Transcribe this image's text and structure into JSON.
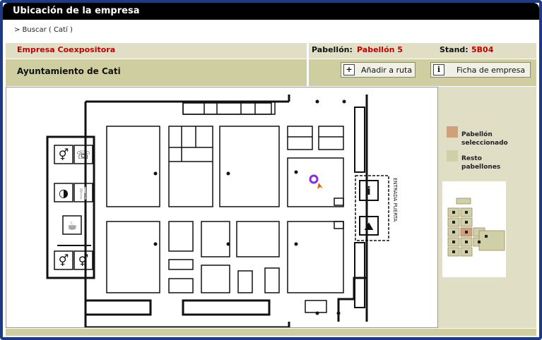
{
  "window": {
    "title": "Ubicación de la empresa"
  },
  "breadcrumb": {
    "text": "> Buscar ( Catí )"
  },
  "company": {
    "section_label": "Empresa Coexpositora",
    "name": "Ayuntamiento de Cati"
  },
  "pavilion": {
    "label": "Pabellón:",
    "value": "Pabellón 5"
  },
  "stand": {
    "label": "Stand:",
    "value": "5B04"
  },
  "buttons": {
    "add_route": "Añadir a ruta",
    "company_sheet": "Ficha de empresa"
  },
  "map": {
    "entrance_text": "ENTRADA PUERTA",
    "selected_marker_color": "#8a2be2"
  },
  "legend": {
    "selected": {
      "label": "Pabellón seleccionado",
      "color": "#d0a07a"
    },
    "rest": {
      "label": "Resto pabellones",
      "color": "#cfd0a8"
    }
  },
  "colors": {
    "frame": "#1a3a8a",
    "accent_red": "#c00000",
    "panel_light": "#e0dfc6",
    "panel_dark": "#cfcea0"
  }
}
